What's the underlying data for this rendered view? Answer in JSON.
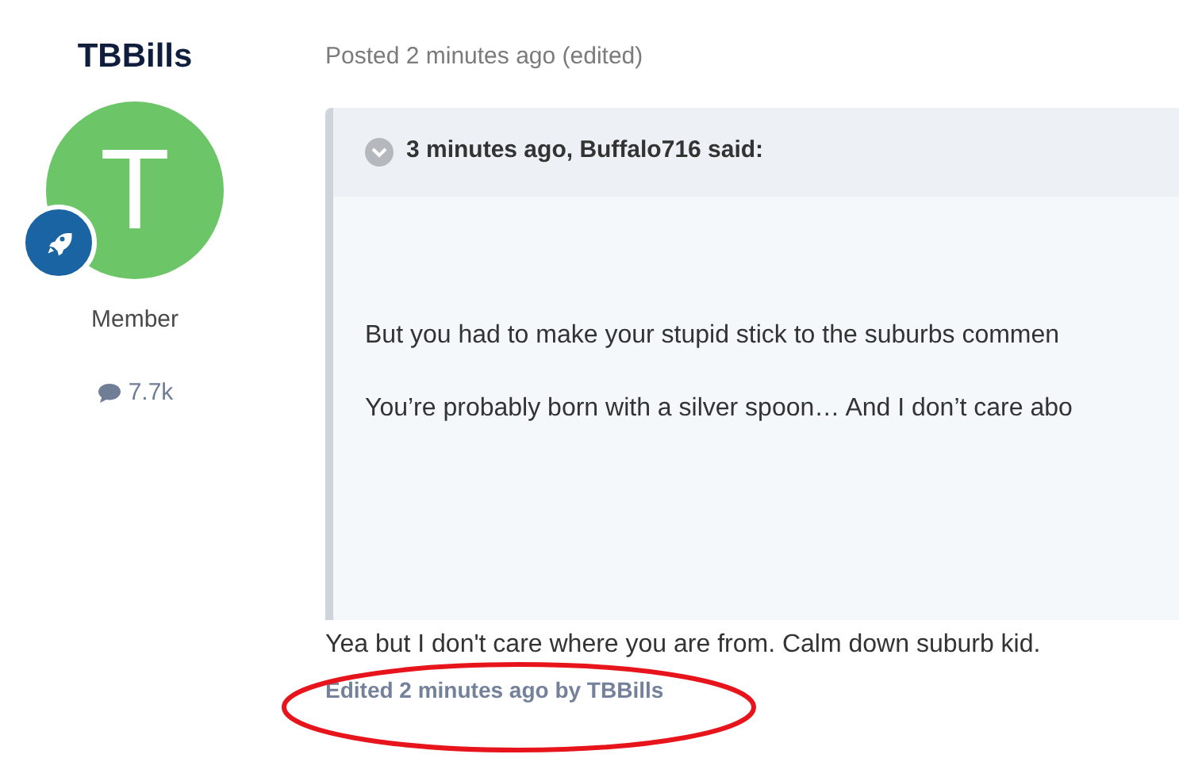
{
  "author": {
    "name": "TBBills",
    "avatar_letter": "T",
    "role": "Member",
    "post_count": "7.7k"
  },
  "post": {
    "meta": "Posted 2 minutes ago (edited)",
    "quote": {
      "expanded": false,
      "citation": "3 minutes ago, Buffalo716 said:",
      "paragraphs": [
        "But you had to make your stupid stick to the suburbs commen",
        "You’re probably born with a silver spoon… And I don’t care abo"
      ]
    },
    "body": "Yea but I don't care where you are from. Calm down suburb kid.",
    "edited_note": "Edited 2 minutes ago by TBBills"
  }
}
